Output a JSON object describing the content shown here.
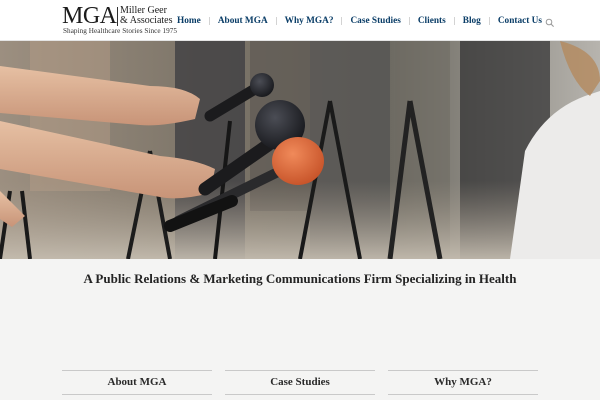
{
  "logo": {
    "mark": "MGA",
    "name_line1": "Miller Geer",
    "name_line2": "& Associates",
    "tagline": "Shaping Healthcare Stories Since 1975"
  },
  "nav": {
    "items": [
      {
        "label": "Home"
      },
      {
        "label": "About MGA"
      },
      {
        "label": "Why MGA?"
      },
      {
        "label": "Case Studies"
      },
      {
        "label": "Clients"
      },
      {
        "label": "Blog"
      },
      {
        "label": "Contact Us"
      }
    ],
    "search_icon": "search-icon"
  },
  "hero": {
    "image_subject": "press-microphones"
  },
  "intro": {
    "heading": "A Public Relations & Marketing Communications Firm Specializing in Health"
  },
  "features": [
    {
      "label": "About MGA"
    },
    {
      "label": "Case Studies"
    },
    {
      "label": "Why MGA?"
    }
  ],
  "colors": {
    "nav_link": "#0a3d67",
    "page_background": "#f4f4f3",
    "header_background": "#ffffff"
  }
}
